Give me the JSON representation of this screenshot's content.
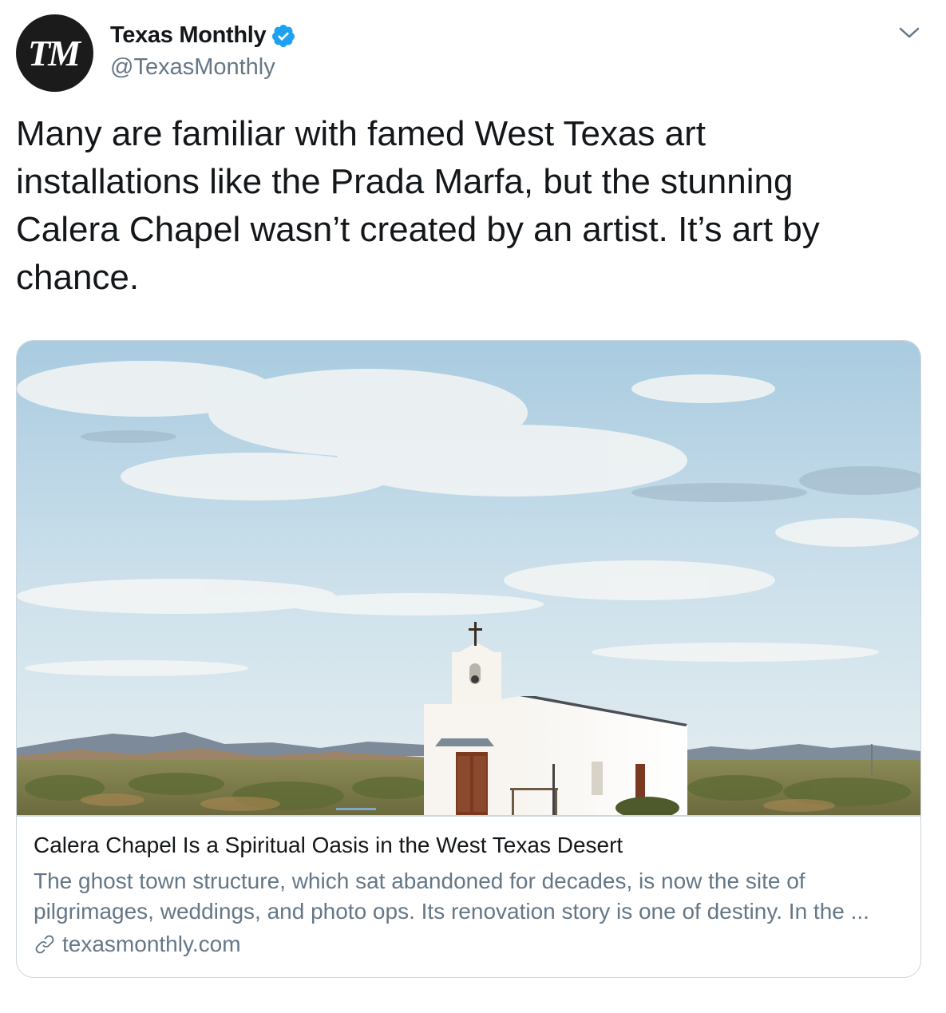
{
  "author": {
    "avatar_text": "TM",
    "display_name": "Texas Monthly",
    "handle": "@TexasMonthly",
    "verified": true
  },
  "tweet": {
    "text": "Many are familiar with famed West Texas art installations like the Prada Marfa, but the stunning Calera Chapel wasn’t created by an artist. It’s art by chance."
  },
  "card": {
    "title": "Calera Chapel Is a Spiritual Oasis in the West Texas Desert",
    "description": "The ghost town structure, which sat abandoned for decades, is now the site of pilgrimages, weddings, and photo ops. Its renovation story is one of destiny. In the ...",
    "domain": "texasmonthly.com"
  },
  "icons": {
    "verified": "verified-badge-icon",
    "menu": "chevron-down-icon",
    "link": "link-icon"
  },
  "colors": {
    "text_primary": "#14171a",
    "text_secondary": "#657786",
    "verified_blue": "#1da1f2",
    "border": "#ccd6dd"
  }
}
